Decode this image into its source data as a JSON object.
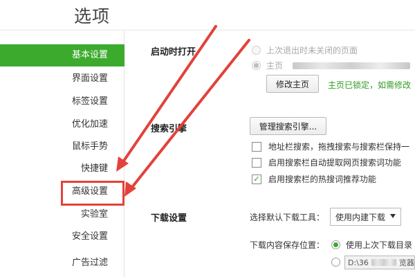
{
  "header": {
    "title": "选项"
  },
  "sidebar": {
    "items": [
      {
        "label": "基本设置",
        "active": true
      },
      {
        "label": "界面设置"
      },
      {
        "label": "标签设置"
      },
      {
        "label": "优化加速"
      },
      {
        "label": "鼠标手势"
      },
      {
        "label": "快捷键"
      },
      {
        "label": "高级设置",
        "highlighted": true
      },
      {
        "label": "实验室"
      },
      {
        "label": "安全设置"
      },
      {
        "label": "广告过滤"
      }
    ]
  },
  "startup": {
    "label": "启动时打开",
    "option_last_session": "上次退出时未关闭的页面",
    "option_home": "主页",
    "modify_home_button": "修改主页",
    "locked_note": "主页已锁定，如需修改"
  },
  "search": {
    "label": "搜索引擎",
    "manage_button": "管理搜索引擎...",
    "options": [
      {
        "label": "地址栏搜索，拖拽搜索与搜索栏保持一",
        "checked": false
      },
      {
        "label": "启用搜索栏自动提取网页搜索词功能",
        "checked": false
      },
      {
        "label": "启用搜索栏的热搜词推荐功能",
        "checked": true
      }
    ]
  },
  "download": {
    "label": "下载设置",
    "tool_label": "选择默认下载工具：",
    "tool_value": "使用内建下载",
    "save_location_label": "下载内容保存位置：",
    "use_last_dir": "使用上次下载目录",
    "path_value": "D:\\36",
    "path_tail": "览器"
  },
  "colors": {
    "accent": "#3caa2c",
    "arrow": "#e2423a",
    "locked_note": "#2f9b21"
  }
}
